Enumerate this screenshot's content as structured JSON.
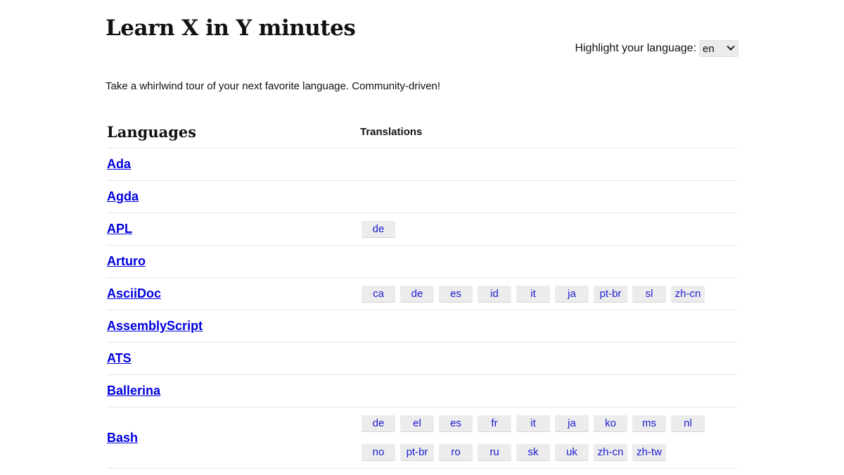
{
  "header": {
    "title": "Learn X in Y minutes",
    "highlight_label": "Highlight your language:",
    "selected_language": "en"
  },
  "tagline": "Take a whirlwind tour of your next favorite language. Community-driven!",
  "table": {
    "col_languages": "Languages",
    "col_translations": "Translations",
    "rows": [
      {
        "name": "Ada",
        "translations": []
      },
      {
        "name": "Agda",
        "translations": []
      },
      {
        "name": "APL",
        "translations": [
          "de"
        ]
      },
      {
        "name": "Arturo",
        "translations": []
      },
      {
        "name": "AsciiDoc",
        "translations": [
          "ca",
          "de",
          "es",
          "id",
          "it",
          "ja",
          "pt-br",
          "sl",
          "zh-cn"
        ]
      },
      {
        "name": "AssemblyScript",
        "translations": []
      },
      {
        "name": "ATS",
        "translations": []
      },
      {
        "name": "Ballerina",
        "translations": []
      },
      {
        "name": "Bash",
        "translations": [
          "de",
          "el",
          "es",
          "fr",
          "it",
          "ja",
          "ko",
          "ms",
          "nl",
          "no",
          "pt-br",
          "ro",
          "ru",
          "sk",
          "uk",
          "zh-cn",
          "zh-tw"
        ]
      }
    ]
  },
  "colors": {
    "link": "#0000dd",
    "chip_bg": "#ececec",
    "divider": "#e6e6e6"
  }
}
